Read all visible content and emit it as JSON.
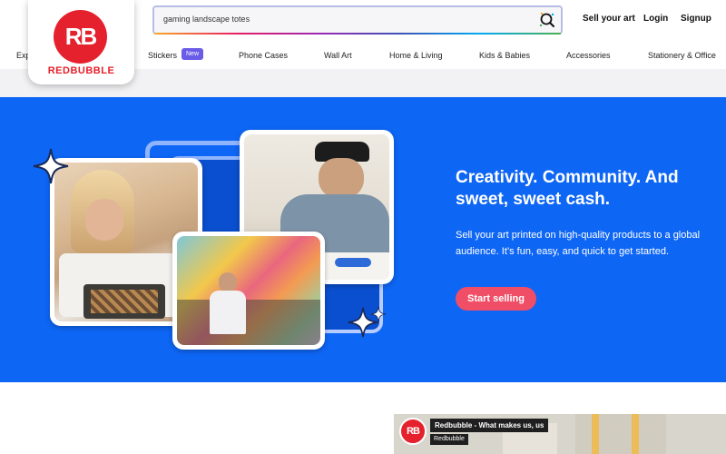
{
  "header": {
    "search": {
      "value": "gaming landscape totes"
    },
    "links": [
      "Sell your art",
      "Login",
      "Signup"
    ]
  },
  "logo": {
    "mark": "RB",
    "wordmark": "REDBUBBLE"
  },
  "nav": {
    "items": [
      "Exp",
      "Stickers",
      "Phone Cases",
      "Wall Art",
      "Home & Living",
      "Kids & Babies",
      "Accessories",
      "Stationery & Office"
    ],
    "badge": "New"
  },
  "hero": {
    "title": "Creativity. Community. And sweet, sweet cash.",
    "body": "Sell your art printed on high-quality products to a global audience. It’s fun, easy, and quick to get started.",
    "cta": "Start selling"
  },
  "video": {
    "mark": "RB",
    "title": "Redbubble - What makes us, us",
    "channel": "Redbubble"
  },
  "colors": {
    "brand_red": "#e4212d",
    "hero_blue": "#0e66f5",
    "cta_pink": "#f04e66",
    "badge_purple": "#6b5ce7"
  },
  "icons": [
    "search-icon",
    "sparkle-icon"
  ]
}
